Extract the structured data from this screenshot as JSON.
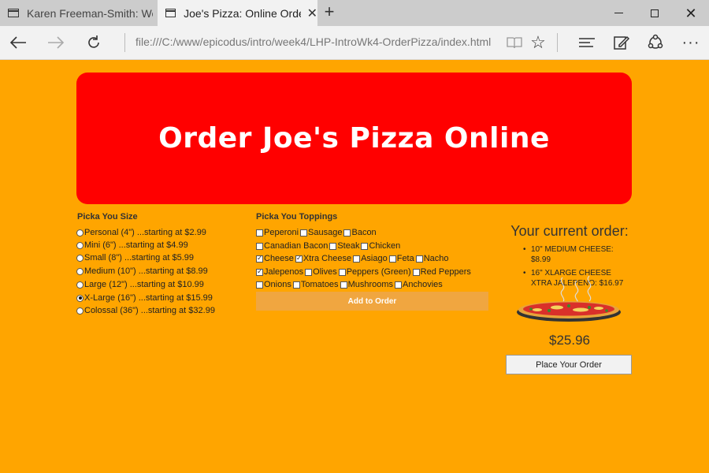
{
  "browser": {
    "tabs": [
      {
        "title": "Karen Freeman-Smith: Web",
        "active": false
      },
      {
        "title": "Joe's Pizza: Online Orde",
        "active": true
      }
    ],
    "new_tab_icon": "plus-icon",
    "url": "file:///C:/www/epicodus/intro/week4/LHP-IntroWk4-OrderPizza/index.html",
    "window_controls": [
      "minimize-icon",
      "maximize-icon",
      "close-icon"
    ],
    "nav_icons": [
      "back-arrow-icon",
      "forward-arrow-icon",
      "refresh-icon",
      "reading-view-icon",
      "star-icon",
      "hub-icon",
      "web-note-icon",
      "share-icon",
      "more-icon"
    ]
  },
  "page": {
    "heading": "Order Joe's Pizza Online",
    "size_section": {
      "title": "Picka You Size",
      "options": [
        {
          "label": "Personal (4\") ...starting at $2.99",
          "checked": false
        },
        {
          "label": "Mini (6\") ...starting at $4.99",
          "checked": false
        },
        {
          "label": "Small (8\") ...starting at $5.99",
          "checked": false
        },
        {
          "label": "Medium (10\") ...starting at $8.99",
          "checked": false
        },
        {
          "label": "Large (12\") ...starting at $10.99",
          "checked": false
        },
        {
          "label": "X-Large (16\") ...starting at $15.99",
          "checked": true
        },
        {
          "label": "Colossal (36\") ...starting at $32.99",
          "checked": false
        }
      ]
    },
    "toppings_section": {
      "title": "Picka You Toppings",
      "rows": [
        [
          {
            "label": "Peperoni",
            "checked": false
          },
          {
            "label": "Sausage",
            "checked": false
          },
          {
            "label": "Bacon",
            "checked": false
          }
        ],
        [
          {
            "label": "Canadian Bacon",
            "checked": false
          },
          {
            "label": "Steak",
            "checked": false
          },
          {
            "label": "Chicken",
            "checked": false
          }
        ],
        [
          {
            "label": "Cheese",
            "checked": true
          },
          {
            "label": "Xtra Cheese",
            "checked": true
          },
          {
            "label": "Asiago",
            "checked": false
          },
          {
            "label": "Feta",
            "checked": false
          },
          {
            "label": "Nacho",
            "checked": false
          }
        ],
        [
          {
            "label": "Jalepenos",
            "checked": true
          },
          {
            "label": "Olives",
            "checked": false
          },
          {
            "label": "Peppers (Green)",
            "checked": false
          },
          {
            "label": "Red Peppers",
            "checked": false
          }
        ],
        [
          {
            "label": "Onions",
            "checked": false
          },
          {
            "label": "Tomatoes",
            "checked": false
          },
          {
            "label": "Mushrooms",
            "checked": false
          },
          {
            "label": "Anchovies",
            "checked": false
          }
        ]
      ],
      "add_button": "Add to Order"
    },
    "order": {
      "title": "Your current order:",
      "items": [
        "10\" MEDIUM CHEESE: $8.99",
        "16\" XLARGE CHEESE XTRA JALEPENO: $16.97"
      ],
      "total": "$25.96",
      "place_button": "Place Your Order"
    }
  }
}
